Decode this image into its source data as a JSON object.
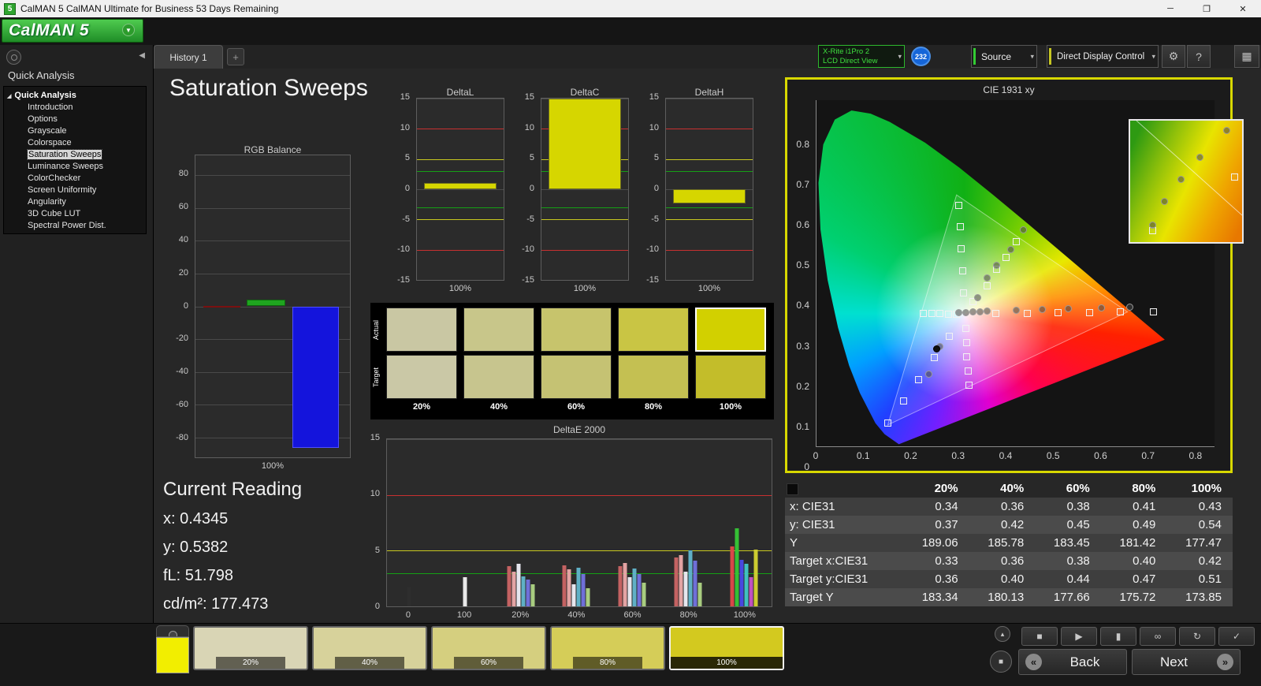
{
  "window": {
    "title": "CalMAN 5 CalMAN Ultimate for Business 53 Days Remaining",
    "app_icon": "5",
    "controls": {
      "minimize": "─",
      "maximize": "❐",
      "close": "✕"
    }
  },
  "logo": {
    "text": "CalMAN 5"
  },
  "icons": {
    "collapse": "◀",
    "expander": "◢",
    "dropdown": "▾",
    "gear": "⚙",
    "help": "?",
    "grid": "▦",
    "logo_arrow": "▼",
    "up": "▴",
    "display": "■"
  },
  "tabs": {
    "history": "History 1",
    "add": "+"
  },
  "toolbar": {
    "meter": {
      "line1": "X-Rite i1Pro 2",
      "line2": "LCD Direct View",
      "badge": "232"
    },
    "source_label": "Source",
    "display_control_label": "Direct Display Control",
    "colors": {
      "meter_green": "#33cc33",
      "badge_blue": "#1565d8",
      "ddc_yellow": "#c6c622"
    }
  },
  "sidebar": {
    "header": "Quick Analysis",
    "tree_root": "Quick Analysis",
    "items": [
      {
        "label": "Introduction",
        "selected": false
      },
      {
        "label": "Options",
        "selected": false
      },
      {
        "label": "Grayscale",
        "selected": false
      },
      {
        "label": "Colorspace",
        "selected": false
      },
      {
        "label": "Saturation Sweeps",
        "selected": true
      },
      {
        "label": "Luminance Sweeps",
        "selected": false
      },
      {
        "label": "ColorChecker",
        "selected": false
      },
      {
        "label": "Screen Uniformity",
        "selected": false
      },
      {
        "label": "Angularity",
        "selected": false
      },
      {
        "label": "3D Cube LUT",
        "selected": false
      },
      {
        "label": "Spectral Power Dist.",
        "selected": false
      }
    ]
  },
  "page": {
    "title": "Saturation Sweeps"
  },
  "current_reading": {
    "title": "Current Reading",
    "lines": [
      "x: 0.4345",
      "y: 0.5382",
      "fL: 51.798",
      "cd/m²: 177.473"
    ]
  },
  "swatch_panel": {
    "row_labels": [
      "Actual",
      "Target"
    ],
    "levels": [
      "20%",
      "40%",
      "60%",
      "80%",
      "100%"
    ],
    "actual_colors": [
      "#c9c7a3",
      "#c8c68a",
      "#c7c46c",
      "#c9c544",
      "#d2d000"
    ],
    "target_colors": [
      "#cac8a6",
      "#c7c58e",
      "#c5c273",
      "#c4c052",
      "#c3bd2a"
    ]
  },
  "table": {
    "columns": [
      "20%",
      "40%",
      "60%",
      "80%",
      "100%"
    ],
    "rows": [
      {
        "label": "x: CIE31",
        "values": [
          "0.34",
          "0.36",
          "0.38",
          "0.41",
          "0.43"
        ]
      },
      {
        "label": "y: CIE31",
        "values": [
          "0.37",
          "0.42",
          "0.45",
          "0.49",
          "0.54"
        ]
      },
      {
        "label": "Y",
        "values": [
          "189.06",
          "185.78",
          "183.45",
          "181.42",
          "177.47"
        ]
      },
      {
        "label": "Target x:CIE31",
        "values": [
          "0.33",
          "0.36",
          "0.38",
          "0.40",
          "0.42"
        ]
      },
      {
        "label": "Target y:CIE31",
        "values": [
          "0.36",
          "0.40",
          "0.44",
          "0.47",
          "0.51"
        ]
      },
      {
        "label": "Target Y",
        "values": [
          "183.34",
          "180.13",
          "177.66",
          "175.72",
          "173.85"
        ]
      }
    ]
  },
  "bottombar": {
    "mini_swatch_color": "#f2ee00",
    "swatches": [
      {
        "label": "20%",
        "color": "#d9d5b5",
        "selected": false
      },
      {
        "label": "40%",
        "color": "#d7d29b",
        "selected": false
      },
      {
        "label": "60%",
        "color": "#d5cf7f",
        "selected": false
      },
      {
        "label": "80%",
        "color": "#d5cd58",
        "selected": false
      },
      {
        "label": "100%",
        "color": "#d3c91f",
        "selected": true
      }
    ],
    "transport": [
      {
        "glyph": "■",
        "name": "stop"
      },
      {
        "glyph": "▶",
        "name": "play"
      },
      {
        "glyph": "▮",
        "name": "pause"
      },
      {
        "glyph": "∞",
        "name": "continuous"
      },
      {
        "glyph": "↻",
        "name": "refresh"
      },
      {
        "glyph": "✓",
        "name": "accept"
      }
    ],
    "back_label": "Back",
    "next_label": "Next",
    "back_arrow": "«",
    "next_arrow": "»"
  },
  "chart_data": [
    {
      "id": "rgb_balance",
      "type": "bar",
      "title": "RGB Balance",
      "xlabel": "100%",
      "categories": [
        "100%"
      ],
      "ylim": [
        -92,
        92
      ],
      "yticks": [
        80,
        60,
        40,
        20,
        0,
        -20,
        -40,
        -60,
        -80
      ],
      "series": [
        {
          "name": "Red",
          "color": "#b51f1f",
          "border": "#7a1010",
          "values": [
            0.4
          ]
        },
        {
          "name": "Green",
          "color": "#1fa51f",
          "border": "#0f6a0f",
          "values": [
            4
          ]
        },
        {
          "name": "Blue",
          "color": "#1414dc",
          "border": "#5050ff",
          "values": [
            -86
          ]
        }
      ]
    },
    {
      "id": "deltaL",
      "type": "bar",
      "title": "DeltaL",
      "xlabel": "100%",
      "categories": [
        "100%"
      ],
      "values": [
        1.0
      ],
      "ylim": [
        -15,
        15
      ],
      "grid": [
        15,
        10,
        5,
        0,
        -5,
        -10,
        -15
      ],
      "ref_lines": [
        {
          "value": 10,
          "color": "#c83030"
        },
        {
          "value": -10,
          "color": "#c83030"
        },
        {
          "value": 5,
          "color": "#c8c820"
        },
        {
          "value": -5,
          "color": "#c8c820"
        },
        {
          "value": 3,
          "color": "#15a015"
        },
        {
          "value": -3,
          "color": "#15a015"
        }
      ]
    },
    {
      "id": "deltaC",
      "type": "bar",
      "title": "DeltaC",
      "xlabel": "100%",
      "categories": [
        "100%"
      ],
      "values": [
        15.5
      ],
      "ylim": [
        -15,
        15
      ],
      "grid": [
        15,
        10,
        5,
        0,
        -5,
        -10,
        -15
      ],
      "ref_lines": [
        {
          "value": 10,
          "color": "#c83030"
        },
        {
          "value": -10,
          "color": "#c83030"
        },
        {
          "value": 5,
          "color": "#c8c820"
        },
        {
          "value": -5,
          "color": "#c8c820"
        },
        {
          "value": 3,
          "color": "#15a015"
        },
        {
          "value": -3,
          "color": "#15a015"
        }
      ]
    },
    {
      "id": "deltaH",
      "type": "bar",
      "title": "DeltaH",
      "xlabel": "100%",
      "categories": [
        "100%"
      ],
      "values": [
        -2.3
      ],
      "ylim": [
        -15,
        15
      ],
      "grid": [
        15,
        10,
        5,
        0,
        -5,
        -10,
        -15
      ],
      "ref_lines": [
        {
          "value": 10,
          "color": "#c83030"
        },
        {
          "value": -10,
          "color": "#c83030"
        },
        {
          "value": 5,
          "color": "#c8c820"
        },
        {
          "value": -5,
          "color": "#c8c820"
        },
        {
          "value": 3,
          "color": "#15a015"
        },
        {
          "value": -3,
          "color": "#15a015"
        }
      ]
    },
    {
      "id": "deltae2000",
      "type": "grouped-bar",
      "title": "DeltaE 2000",
      "ylim": [
        0,
        15
      ],
      "grid": [
        5,
        10,
        15
      ],
      "yticks": [
        15,
        10,
        5,
        0
      ],
      "ref_lines": [
        {
          "value": 10,
          "color": "#c83030"
        },
        {
          "value": 5,
          "color": "#c8c820"
        },
        {
          "value": 3,
          "color": "#15a015"
        }
      ],
      "groups": [
        {
          "label": "0",
          "bars": [
            {
              "color": "#2e2e2e",
              "value": 1.7
            }
          ]
        },
        {
          "label": "100",
          "bars": [
            {
              "color": "#e8e8e8",
              "value": 2.6
            }
          ]
        },
        {
          "label": "20%",
          "bars": [
            {
              "color": "#c46262",
              "value": 3.6
            },
            {
              "color": "#e3a3a3",
              "value": 3.1
            },
            {
              "color": "#e6e6ee",
              "value": 3.8
            },
            {
              "color": "#5fb0c6",
              "value": 2.7
            },
            {
              "color": "#6f6fd8",
              "value": 2.4
            },
            {
              "color": "#a8cc80",
              "value": 2.0
            }
          ]
        },
        {
          "label": "40%",
          "bars": [
            {
              "color": "#c46262",
              "value": 3.7
            },
            {
              "color": "#e3a3a3",
              "value": 3.3
            },
            {
              "color": "#e6e6ee",
              "value": 2.0
            },
            {
              "color": "#5fb0c6",
              "value": 3.5
            },
            {
              "color": "#6f6fd8",
              "value": 2.9
            },
            {
              "color": "#a8cc80",
              "value": 1.6
            }
          ]
        },
        {
          "label": "60%",
          "bars": [
            {
              "color": "#c46262",
              "value": 3.6
            },
            {
              "color": "#e3a3a3",
              "value": 3.9
            },
            {
              "color": "#e6e6ee",
              "value": 2.6
            },
            {
              "color": "#5fb0c6",
              "value": 3.4
            },
            {
              "color": "#6f6fd8",
              "value": 2.9
            },
            {
              "color": "#a8cc80",
              "value": 2.1
            }
          ]
        },
        {
          "label": "80%",
          "bars": [
            {
              "color": "#c46262",
              "value": 4.4
            },
            {
              "color": "#e3a3a3",
              "value": 4.6
            },
            {
              "color": "#e6e6ee",
              "value": 3.1
            },
            {
              "color": "#5fb0c6",
              "value": 5.0
            },
            {
              "color": "#6f6fd8",
              "value": 4.1
            },
            {
              "color": "#a8cc80",
              "value": 2.1
            }
          ]
        },
        {
          "label": "100%",
          "bars": [
            {
              "color": "#d84848",
              "value": 5.4
            },
            {
              "color": "#35c035",
              "value": 7.0
            },
            {
              "color": "#4848e0",
              "value": 4.2
            },
            {
              "color": "#40c0c0",
              "value": 3.8
            },
            {
              "color": "#c050c0",
              "value": 2.6
            },
            {
              "color": "#cccc30",
              "value": 5.1
            }
          ]
        }
      ]
    },
    {
      "id": "cie1931",
      "type": "scatter",
      "title": "CIE 1931 xy",
      "xlim": [
        0,
        0.84
      ],
      "ylim": [
        0,
        0.86
      ],
      "x_ticks": [
        "0",
        "0.1",
        "0.2",
        "0.3",
        "0.4",
        "0.5",
        "0.6",
        "0.7",
        "0.8"
      ],
      "y_ticks": [
        "0",
        "0.1",
        "0.2",
        "0.3",
        "0.4",
        "0.5",
        "0.6",
        "0.7",
        "0.8"
      ],
      "gamut_triangle": [
        [
          0.295,
          0.625
        ],
        [
          0.655,
          0.335
        ],
        [
          0.15,
          0.055
        ]
      ],
      "targets": [
        [
          0.378,
          0.331
        ],
        [
          0.444,
          0.332
        ],
        [
          0.509,
          0.333
        ],
        [
          0.575,
          0.334
        ],
        [
          0.64,
          0.335
        ],
        [
          0.71,
          0.336
        ],
        [
          0.295,
          0.33
        ],
        [
          0.278,
          0.33
        ],
        [
          0.26,
          0.331
        ],
        [
          0.243,
          0.331
        ],
        [
          0.225,
          0.332
        ],
        [
          0.31,
          0.383
        ],
        [
          0.308,
          0.437
        ],
        [
          0.305,
          0.492
        ],
        [
          0.303,
          0.546
        ],
        [
          0.3,
          0.6
        ],
        [
          0.28,
          0.275
        ],
        [
          0.248,
          0.221
        ],
        [
          0.215,
          0.167
        ],
        [
          0.183,
          0.114
        ],
        [
          0.15,
          0.06
        ],
        [
          0.314,
          0.294
        ],
        [
          0.316,
          0.259
        ],
        [
          0.317,
          0.224
        ],
        [
          0.319,
          0.189
        ],
        [
          0.321,
          0.154
        ],
        [
          0.33,
          0.36
        ],
        [
          0.36,
          0.4
        ],
        [
          0.38,
          0.44
        ],
        [
          0.4,
          0.47
        ],
        [
          0.42,
          0.51
        ]
      ],
      "measurements": [
        [
          0.34,
          0.37
        ],
        [
          0.36,
          0.42
        ],
        [
          0.38,
          0.45
        ],
        [
          0.41,
          0.49
        ],
        [
          0.435,
          0.538
        ],
        [
          0.3,
          0.333
        ],
        [
          0.315,
          0.334
        ],
        [
          0.33,
          0.335
        ],
        [
          0.345,
          0.336
        ],
        [
          0.36,
          0.337
        ],
        [
          0.42,
          0.34
        ],
        [
          0.475,
          0.342
        ],
        [
          0.53,
          0.344
        ],
        [
          0.6,
          0.345
        ],
        [
          0.66,
          0.346
        ],
        [
          0.26,
          0.25
        ],
        [
          0.237,
          0.18
        ]
      ],
      "filled": [
        [
          0.253,
          0.243
        ]
      ],
      "inset": {
        "squares": [
          [
            20,
            90
          ],
          [
            93,
            46
          ]
        ],
        "circles": [
          [
            86,
            8
          ],
          [
            62,
            30
          ],
          [
            45,
            48
          ],
          [
            30,
            66
          ],
          [
            20,
            86
          ]
        ]
      }
    }
  ]
}
